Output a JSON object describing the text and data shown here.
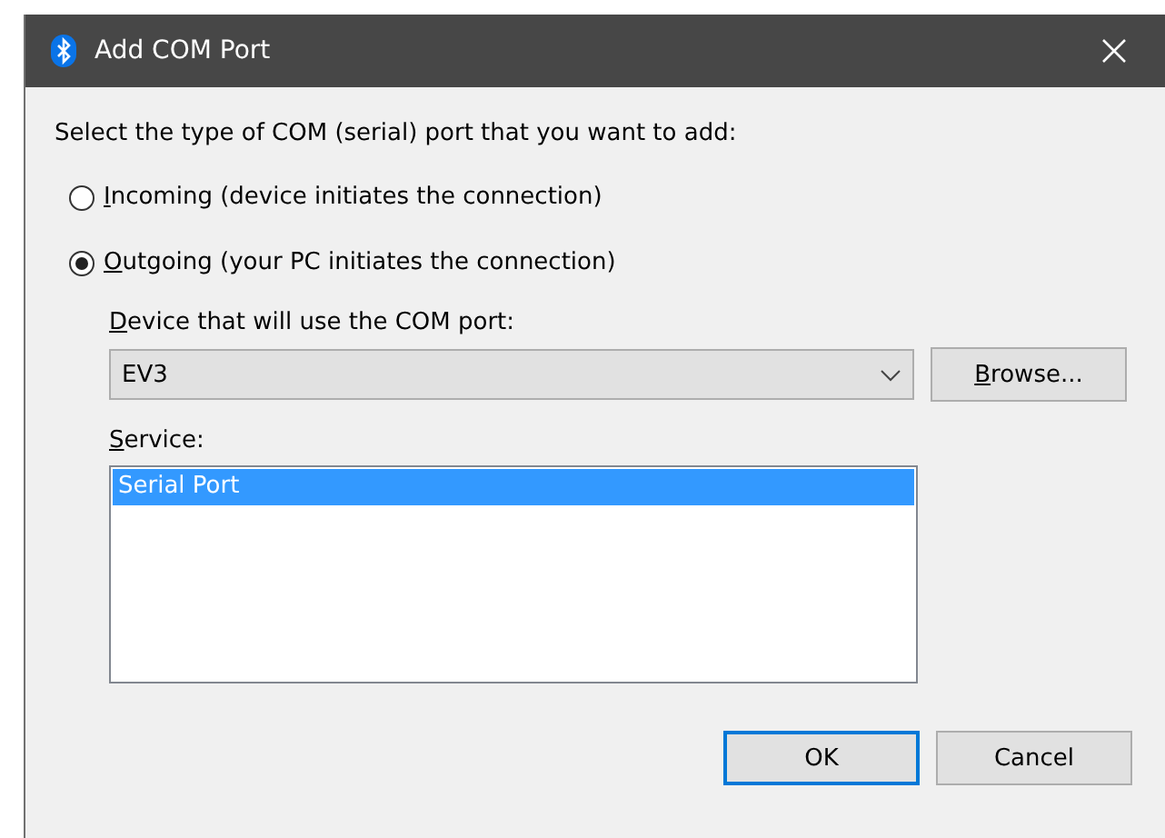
{
  "window": {
    "title": "Add COM Port"
  },
  "prompt": "Select the type of COM (serial) port that you want to add:",
  "port_types": [
    {
      "access_key": "I",
      "text": "ncoming (device initiates the connection)",
      "selected": false
    },
    {
      "access_key": "O",
      "text": "utgoing (your PC initiates the connection)",
      "selected": true
    }
  ],
  "device": {
    "label_access_key": "D",
    "label_text": "evice that will use the COM port:",
    "value": "EV3",
    "browse_access_key": "B",
    "browse_text": "rowse..."
  },
  "service": {
    "label_access_key": "S",
    "label_text": "ervice:",
    "items": [
      {
        "text": "Serial Port",
        "selected": true
      }
    ]
  },
  "buttons": [
    {
      "label": "OK",
      "default": true
    },
    {
      "label": "Cancel",
      "default": false
    }
  ]
}
